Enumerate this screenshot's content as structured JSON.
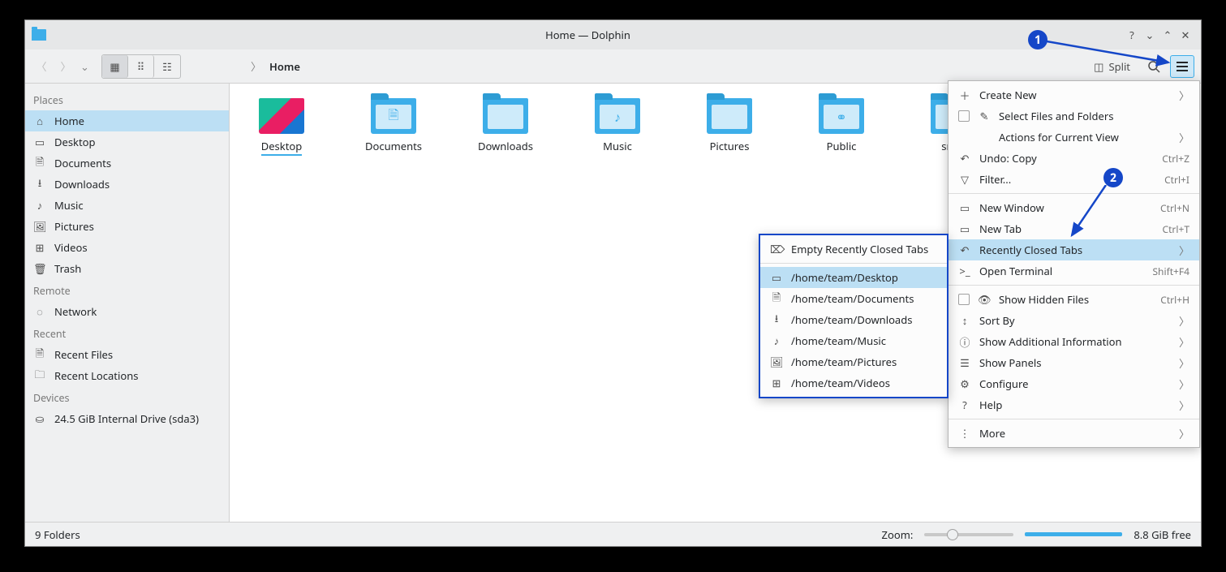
{
  "titlebar": {
    "title": "Home — Dolphin"
  },
  "toolbar": {
    "split": "Split",
    "breadcrumb": "Home"
  },
  "sidebar": {
    "places_head": "Places",
    "places": [
      {
        "icon": "⌂",
        "label": "Home"
      },
      {
        "icon": "▭",
        "label": "Desktop"
      },
      {
        "icon": "🗎",
        "label": "Documents"
      },
      {
        "icon": "⭳",
        "label": "Downloads"
      },
      {
        "icon": "♪",
        "label": "Music"
      },
      {
        "icon": "🖼",
        "label": "Pictures"
      },
      {
        "icon": "⊞",
        "label": "Videos"
      },
      {
        "icon": "🗑",
        "label": "Trash"
      }
    ],
    "remote_head": "Remote",
    "remote": [
      {
        "icon": "◌",
        "label": "Network"
      }
    ],
    "recent_head": "Recent",
    "recent": [
      {
        "icon": "🗎",
        "label": "Recent Files"
      },
      {
        "icon": "🗀",
        "label": "Recent Locations"
      }
    ],
    "devices_head": "Devices",
    "devices": [
      {
        "icon": "⛀",
        "label": "24.5 GiB Internal Drive (sda3)"
      }
    ]
  },
  "folders": [
    {
      "label": "Desktop",
      "kind": "desktop",
      "sel": true
    },
    {
      "label": "Documents",
      "inner": "🗎"
    },
    {
      "label": "Downloads",
      "inner": ""
    },
    {
      "label": "Music",
      "inner": "♪"
    },
    {
      "label": "Pictures",
      "inner": ""
    },
    {
      "label": "Public",
      "inner": "⚭"
    },
    {
      "label": "snap",
      "inner": ""
    }
  ],
  "status": {
    "count": "9 Folders",
    "zoom": "Zoom:",
    "free": "8.8 GiB free"
  },
  "main_menu": [
    {
      "icon": "＋",
      "label": "Create New",
      "arrow": true
    },
    {
      "check": true,
      "icon": "✎",
      "label": "Select Files and Folders"
    },
    {
      "pad": true,
      "label": "Actions for Current View",
      "arrow": true
    },
    {
      "icon": "↶",
      "label": "Undo: Copy",
      "short": "Ctrl+Z"
    },
    {
      "icon": "▽",
      "label": "Filter...",
      "short": "Ctrl+I"
    },
    {
      "sep": true
    },
    {
      "icon": "▭",
      "label": "New Window",
      "short": "Ctrl+N"
    },
    {
      "icon": "▭",
      "label": "New Tab",
      "short": "Ctrl+T"
    },
    {
      "icon": "↶",
      "label": "Recently Closed Tabs",
      "arrow": true,
      "hl": true
    },
    {
      "icon": ">_",
      "label": "Open Terminal",
      "short": "Shift+F4"
    },
    {
      "sep": true
    },
    {
      "check": true,
      "icon": "👁",
      "label": "Show Hidden Files",
      "short": "Ctrl+H"
    },
    {
      "icon": "↕",
      "label": "Sort By",
      "arrow": true
    },
    {
      "icon": "ⓘ",
      "label": "Show Additional Information",
      "arrow": true
    },
    {
      "icon": "☰",
      "label": "Show Panels",
      "arrow": true
    },
    {
      "icon": "⚙",
      "label": "Configure",
      "arrow": true
    },
    {
      "icon": "?",
      "label": "Help",
      "arrow": true
    },
    {
      "sep": true
    },
    {
      "icon": "⋮",
      "label": "More",
      "arrow": true
    }
  ],
  "sub_menu": [
    {
      "icon": "⌦",
      "label": "Empty Recently Closed Tabs"
    },
    {
      "sep": true
    },
    {
      "icon": "▭",
      "label": "/home/team/Desktop",
      "hl": true
    },
    {
      "icon": "🗎",
      "label": "/home/team/Documents"
    },
    {
      "icon": "⭳",
      "label": "/home/team/Downloads"
    },
    {
      "icon": "♪",
      "label": "/home/team/Music"
    },
    {
      "icon": "🖼",
      "label": "/home/team/Pictures"
    },
    {
      "icon": "⊞",
      "label": "/home/team/Videos"
    }
  ],
  "callouts": {
    "c1": "1",
    "c2": "2"
  }
}
